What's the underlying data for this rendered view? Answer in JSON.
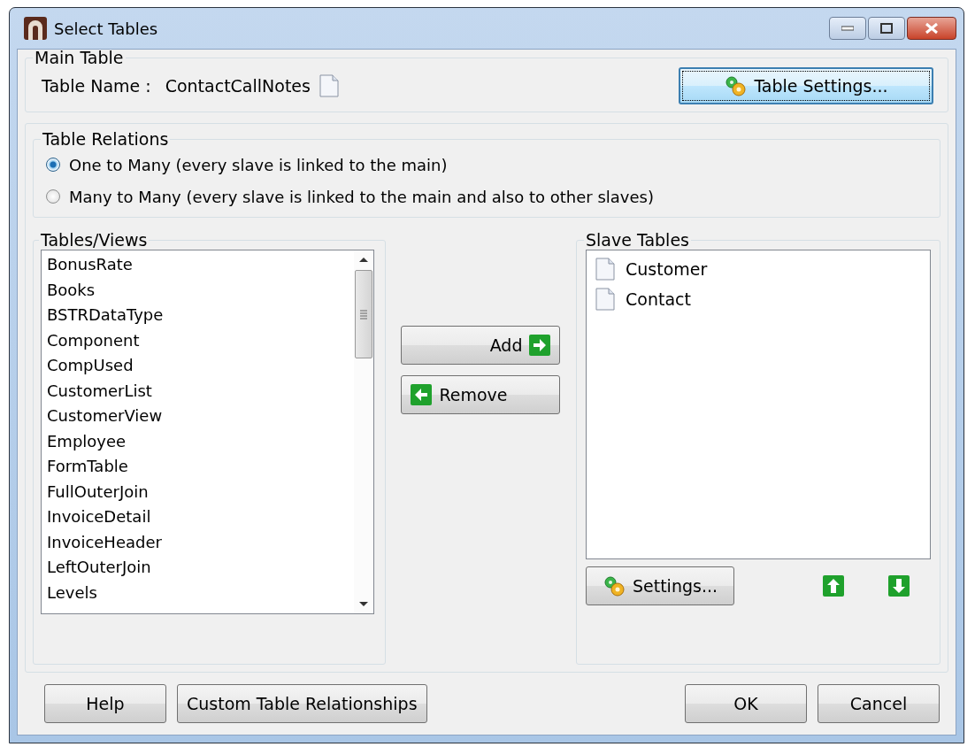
{
  "window": {
    "title": "Select Tables"
  },
  "main_table": {
    "legend": "Main Table",
    "name_label": "Table Name :",
    "name_value": "ContactCallNotes",
    "settings_button": {
      "label": "Table Settings...",
      "focused": true
    }
  },
  "relations": {
    "legend": "Table Relations",
    "options": [
      {
        "label": "One to Many (every slave is linked to the main)",
        "selected": true
      },
      {
        "label": "Many to Many (every slave is linked to the main and also to other slaves)",
        "selected": false
      }
    ]
  },
  "tables_views": {
    "legend": "Tables/Views",
    "items": [
      "BonusRate",
      "Books",
      "BSTRDataType",
      "Component",
      "CompUsed",
      "CustomerList",
      "CustomerView",
      "Employee",
      "FormTable",
      "FullOuterJoin",
      "InvoiceDetail",
      "InvoiceHeader",
      "LeftOuterJoin",
      "Levels"
    ]
  },
  "add_button": "Add",
  "remove_button": "Remove",
  "slave_tables": {
    "legend": "Slave Tables",
    "items": [
      "Customer",
      "Contact"
    ],
    "settings_button": "Settings..."
  },
  "footer_left_buttons": [
    "Help",
    "Custom Table Relationships"
  ],
  "footer_right_buttons": [
    "OK",
    "Cancel"
  ]
}
